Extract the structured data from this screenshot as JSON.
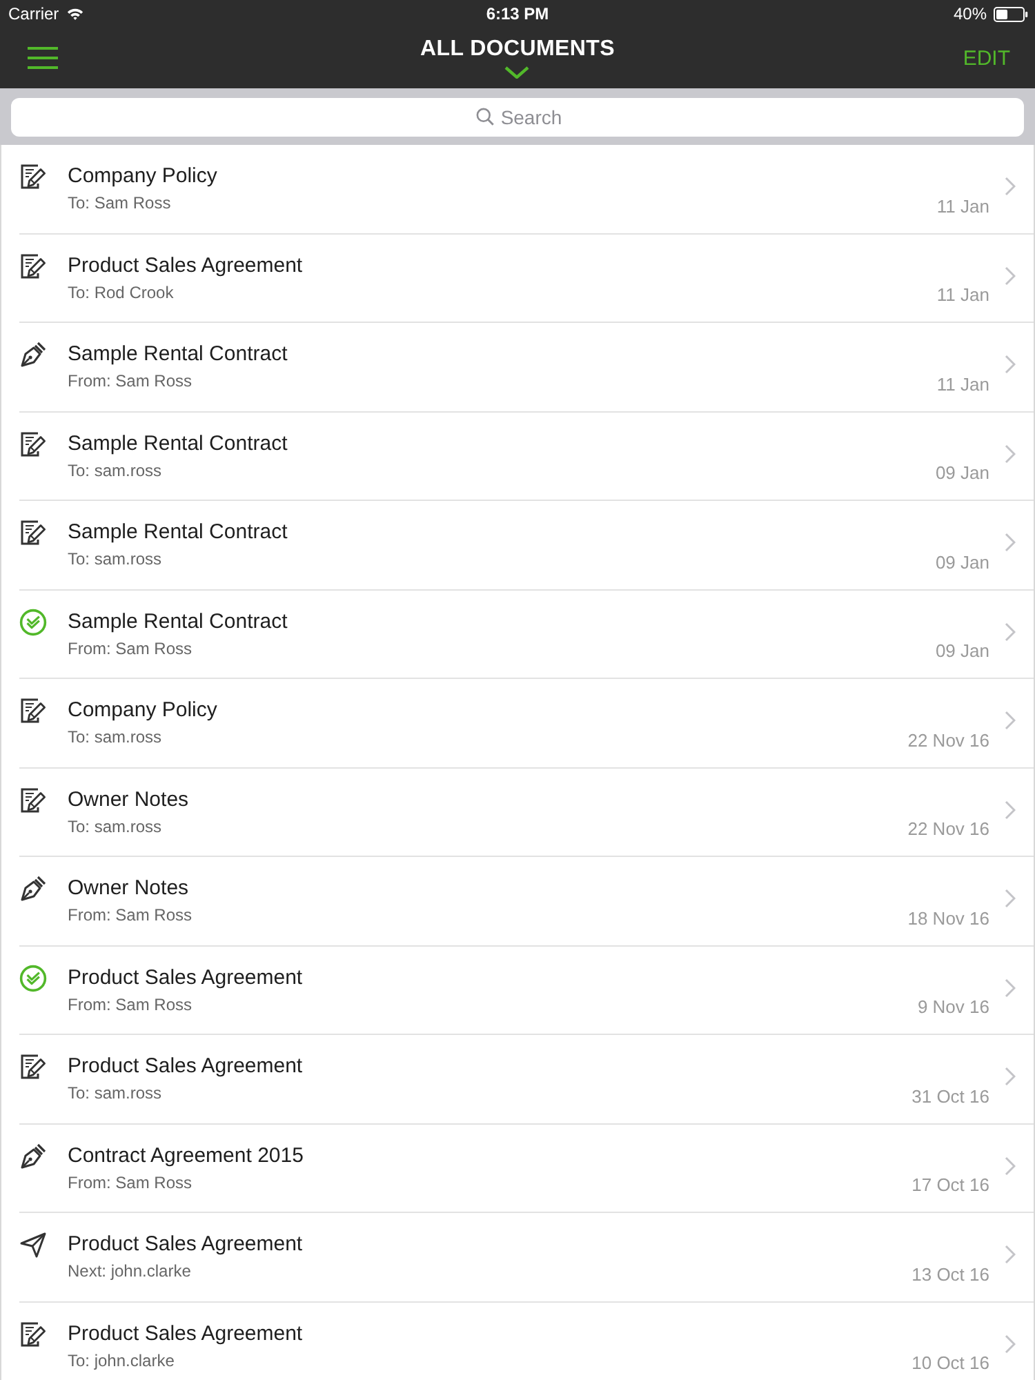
{
  "status_bar": {
    "carrier": "Carrier",
    "time": "6:13 PM",
    "battery": "40%"
  },
  "nav_bar": {
    "title": "ALL DOCUMENTS",
    "edit": "EDIT"
  },
  "search": {
    "placeholder": "Search"
  },
  "documents": [
    {
      "kind": "draft",
      "title": "Company Policy",
      "subtitle": "To: Sam Ross",
      "date": "11 Jan"
    },
    {
      "kind": "draft",
      "title": "Product Sales Agreement",
      "subtitle": "To: Rod Crook",
      "date": "11 Jan"
    },
    {
      "kind": "sign",
      "title": "Sample Rental Contract",
      "subtitle": "From: Sam Ross",
      "date": "11 Jan"
    },
    {
      "kind": "draft",
      "title": "Sample Rental Contract",
      "subtitle": "To: sam.ross",
      "date": "09 Jan"
    },
    {
      "kind": "draft",
      "title": "Sample Rental Contract",
      "subtitle": "To: sam.ross",
      "date": "09 Jan"
    },
    {
      "kind": "completed",
      "title": "Sample Rental Contract",
      "subtitle": "From: Sam Ross",
      "date": "09 Jan"
    },
    {
      "kind": "draft",
      "title": "Company Policy",
      "subtitle": "To: sam.ross",
      "date": "22 Nov 16"
    },
    {
      "kind": "draft",
      "title": "Owner Notes",
      "subtitle": "To: sam.ross",
      "date": "22 Nov 16"
    },
    {
      "kind": "sign",
      "title": "Owner Notes",
      "subtitle": "From: Sam Ross",
      "date": "18 Nov 16"
    },
    {
      "kind": "completed",
      "title": "Product Sales Agreement",
      "subtitle": "From: Sam Ross",
      "date": "9 Nov 16"
    },
    {
      "kind": "draft",
      "title": "Product Sales Agreement",
      "subtitle": "To: sam.ross",
      "date": "31 Oct 16"
    },
    {
      "kind": "sign",
      "title": "Contract Agreement 2015",
      "subtitle": "From: Sam Ross",
      "date": "17 Oct 16"
    },
    {
      "kind": "sent",
      "title": "Product Sales Agreement",
      "subtitle": "Next: john.clarke",
      "date": "13 Oct 16"
    },
    {
      "kind": "draft",
      "title": "Product Sales Agreement",
      "subtitle": "To: john.clarke",
      "date": "10 Oct 16"
    }
  ]
}
